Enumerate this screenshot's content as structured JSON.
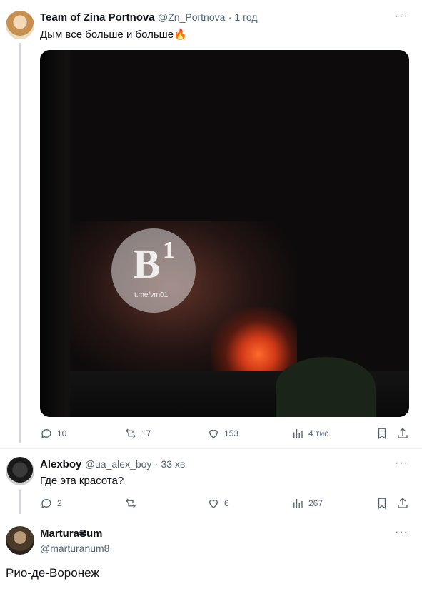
{
  "tweet1": {
    "name": "Team of Zina Portnova",
    "handle": "@Zn_Portnova",
    "time": "· 1 год",
    "text": "Дым все больше и больше",
    "emoji": "🔥",
    "watermark_logo": "В",
    "watermark_superscript": "1",
    "watermark_url": "t.me/vrn01",
    "replies": "10",
    "retweets": "17",
    "likes": "153",
    "views": "4 тис."
  },
  "tweet2": {
    "name": "Alexboy",
    "handle": "@ua_alex_boy",
    "time": "· 33 хв",
    "text": "Где эта красота?",
    "replies": "2",
    "retweets": "",
    "likes": "6",
    "views": "267"
  },
  "tweet3": {
    "name": "Martura₴um",
    "handle": "@marturanum8",
    "text": "Рио-де-Воронеж"
  },
  "more": "···",
  "colors": {
    "text": "#0f1419",
    "secondary": "#536471",
    "line": "#cfd9de"
  }
}
